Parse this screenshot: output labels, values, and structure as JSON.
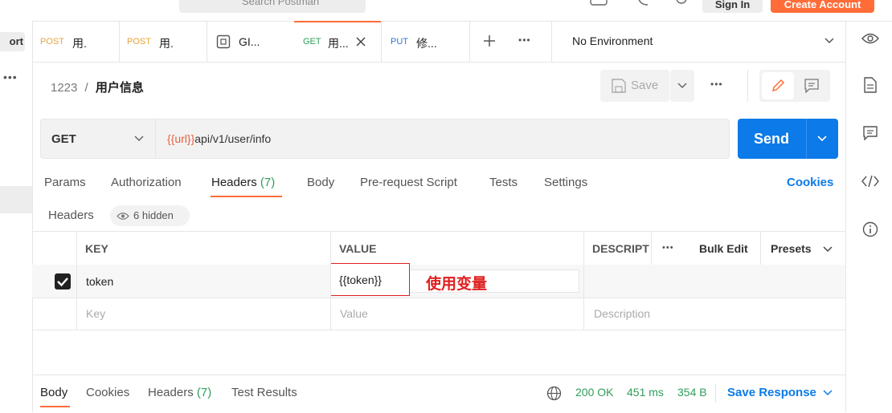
{
  "topbar": {
    "search_placeholder": "Search Postman",
    "signin_label": "Sign In",
    "create_label": "Create Account"
  },
  "sidebar": {
    "import_label": "ort"
  },
  "tabs": [
    {
      "method": "POST",
      "title": "用.",
      "method_color": "#e8a33b"
    },
    {
      "method": "POST",
      "title": "用.",
      "method_color": "#e8a33b"
    },
    {
      "method": "",
      "title": "GI...",
      "method_color": ""
    },
    {
      "method": "GET",
      "title": "用...",
      "method_color": "#2e9e5b"
    },
    {
      "method": "PUT",
      "title": "修...",
      "method_color": "#2b77d6"
    }
  ],
  "environment": {
    "selected": "No Environment"
  },
  "request": {
    "collection": "1223",
    "separator": "/",
    "name": "用户信息",
    "save_label": "Save",
    "method": "GET",
    "url_var": "{{url}}",
    "url_path": "api/v1/user/info",
    "send_label": "Send"
  },
  "subtabs": {
    "params": "Params",
    "authorization": "Authorization",
    "headers": "Headers",
    "headers_count": "(7)",
    "body": "Body",
    "prerequest": "Pre-request Script",
    "tests": "Tests",
    "settings": "Settings",
    "cookies": "Cookies"
  },
  "headers_section": {
    "title": "Headers",
    "hidden": "6 hidden"
  },
  "table": {
    "col_key": "KEY",
    "col_value": "VALUE",
    "col_desc": "DESCRIPT",
    "bulk_edit": "Bulk Edit",
    "presets": "Presets",
    "row1": {
      "key": "token",
      "value": "{{token}}",
      "annotation": "使用变量"
    },
    "placeholder": {
      "key": "Key",
      "value": "Value",
      "desc": "Description"
    }
  },
  "response": {
    "body": "Body",
    "cookies": "Cookies",
    "headers": "Headers",
    "headers_count": "(7)",
    "test_results": "Test Results",
    "status": "200 OK",
    "time": "451 ms",
    "size": "354 B",
    "save_response": "Save Response"
  },
  "colors": {
    "accent": "#ff6c37",
    "send": "#0c7ae8",
    "link": "#0c7ae8",
    "var": "#e8603c",
    "status_ok": "#2e9e5b",
    "annotation": "#e02020"
  }
}
